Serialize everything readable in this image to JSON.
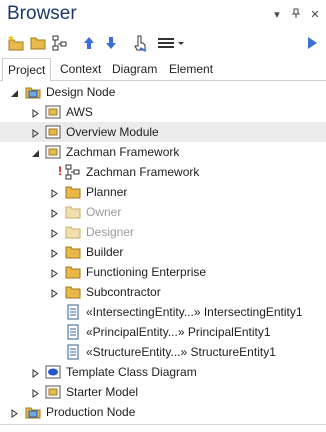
{
  "panel": {
    "title": "Browser"
  },
  "window_controls": {
    "dropdown": "▾",
    "pin": "ㅍ",
    "close": "✕"
  },
  "tabs": [
    {
      "label": "Project",
      "active": true
    },
    {
      "label": "Context",
      "active": false
    },
    {
      "label": "Diagram",
      "active": false
    },
    {
      "label": "Element",
      "active": false
    }
  ],
  "tree": {
    "design_node": "Design Node",
    "aws": "AWS",
    "overview_module": "Overview Module",
    "zachman_package": "Zachman Framework",
    "zachman_diagram": "Zachman Framework",
    "planner": "Planner",
    "owner": "Owner",
    "designer": "Designer",
    "builder": "Builder",
    "functioning_enterprise": "Functioning Enterprise",
    "subcontractor": "Subcontractor",
    "intersecting": "«IntersectingEntity...» IntersectingEntity1",
    "principal": "«PrincipalEntity...» PrincipalEntity1",
    "structure": "«StructureEntity...» StructureEntity1",
    "template_class_diagram": "Template Class Diagram",
    "starter_model": "Starter Model",
    "production_node": "Production Node"
  },
  "colors": {
    "title": "#1b3a6b",
    "selection": "#ebebeb",
    "folder": "#e8b84a",
    "toolbar_blue": "#3a6fd8"
  }
}
